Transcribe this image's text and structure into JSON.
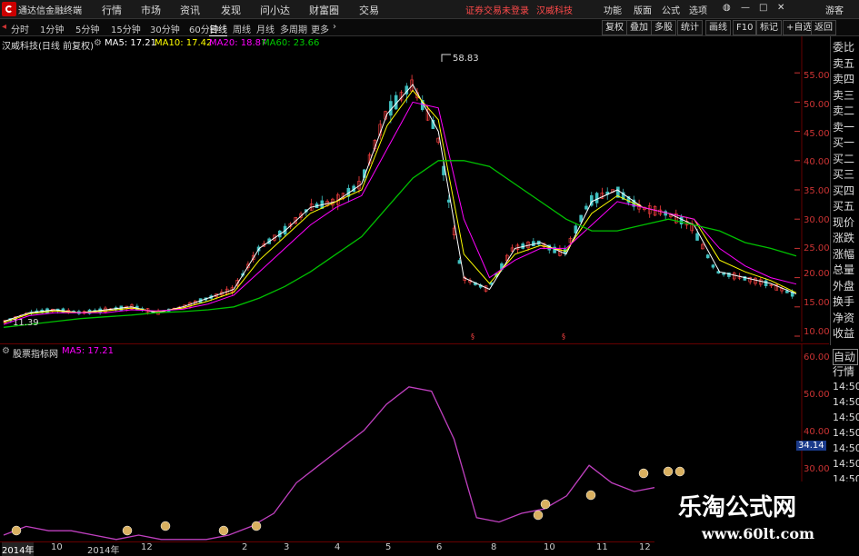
{
  "menubar": {
    "app_title": "通达信金融终端",
    "items": [
      "行情",
      "市场",
      "资讯",
      "发现",
      "问小达",
      "财富圈",
      "交易"
    ],
    "notice": "证券交易未登录",
    "stock_link": "汉威科技",
    "right_items": [
      "功能",
      "版面",
      "公式",
      "选项"
    ],
    "guest": "游客"
  },
  "toolbar": {
    "periods": [
      "分时",
      "1分钟",
      "5分钟",
      "15分钟",
      "30分钟",
      "60分钟",
      "日线",
      "周线",
      "月线",
      "多周期",
      "更多"
    ],
    "active_period": "日线",
    "right_buttons": [
      "复权",
      "叠加",
      "多股",
      "统计",
      "画线",
      "F10",
      "标记",
      "+自选",
      "返回"
    ]
  },
  "main_chart": {
    "title": "汉威科技(日线 前复权)",
    "ma5_label": "MA5: 17.21",
    "ma10_label": "MA10: 17.42",
    "ma20_label": "MA20: 18.87",
    "ma60_label": "MA60: 23.66",
    "high_label": "58.83",
    "low_label": "11.39",
    "y_ticks": [
      "55.00",
      "50.00",
      "45.00",
      "40.00",
      "35.00",
      "30.00",
      "25.00",
      "20.00",
      "15.00",
      "10.00"
    ],
    "colors": {
      "ma5": "#ffffff",
      "ma10": "#ffff00",
      "ma20": "#ff00ff",
      "ma60": "#00c000",
      "up": "#ff4040",
      "down": "#40c0c0"
    }
  },
  "sub_chart": {
    "title": "股票指标网",
    "ma5_label": "MA5: 17.21",
    "y_ticks": [
      "60.00",
      "50.00",
      "40.00",
      "30.00"
    ],
    "current_value": "34.14"
  },
  "right_panel": {
    "items": [
      "委比",
      "卖五",
      "卖四",
      "卖三",
      "卖二",
      "卖一",
      "买一",
      "买二",
      "买三",
      "买四",
      "买五",
      "现价",
      "涨跌",
      "涨幅",
      "总量",
      "外盘",
      "换手",
      "净资",
      "收益"
    ],
    "lower_items": [
      "自动",
      "行情",
      "14:50",
      "14:50",
      "14:50",
      "14:50",
      "14:50",
      "14:50",
      "14:50",
      "14:50"
    ]
  },
  "date_axis": {
    "labels": [
      "2014年",
      "10",
      "2014年",
      "12",
      "2",
      "3",
      "4",
      "5",
      "6",
      "8",
      "10",
      "11",
      "12"
    ]
  },
  "watermark": {
    "title": "乐淘公式网",
    "url": "www.60lt.com"
  },
  "chart_data": {
    "type": "line",
    "title": "汉威科技(日线 前复权)",
    "ylim": [
      10,
      60
    ],
    "series": [
      {
        "name": "MA5",
        "values": [
          12.5,
          14,
          14.5,
          14,
          14.5,
          15,
          14,
          15,
          16.5,
          18,
          25,
          28,
          32,
          33,
          36,
          48,
          53,
          45,
          20,
          18,
          25,
          26,
          24,
          33,
          35,
          32,
          31,
          29,
          21,
          20,
          19,
          17.2
        ]
      },
      {
        "name": "MA10",
        "values": [
          12.3,
          13.8,
          14.3,
          14,
          14.3,
          14.8,
          14.2,
          14.8,
          16,
          17.5,
          23,
          27,
          31,
          33,
          35,
          46,
          52,
          47,
          24,
          19,
          24,
          25.5,
          24.5,
          31,
          34,
          32,
          31,
          30,
          23,
          21,
          19.5,
          17.4
        ]
      },
      {
        "name": "MA20",
        "values": [
          12,
          13.5,
          14,
          14,
          14,
          14.5,
          14.3,
          14.6,
          15.5,
          17,
          21,
          25,
          29,
          32,
          34,
          42,
          50,
          49,
          30,
          20,
          23,
          25,
          25,
          29,
          33,
          32,
          31,
          30,
          25,
          22,
          20,
          18.9
        ]
      },
      {
        "name": "MA60",
        "values": [
          11.5,
          12,
          12.5,
          13,
          13.3,
          13.6,
          14,
          14.2,
          14.5,
          15,
          16.5,
          18.5,
          21,
          24,
          27,
          32,
          37,
          40,
          40,
          39,
          36,
          33,
          30,
          28,
          28,
          29,
          30,
          29,
          28,
          26,
          25,
          23.7
        ]
      }
    ],
    "sub_series": {
      "name": "MA5",
      "values": [
        20,
        22,
        21,
        21,
        20,
        19,
        20,
        19,
        19,
        19,
        20,
        22,
        25,
        32,
        36,
        40,
        44,
        50,
        54,
        53,
        42,
        24,
        23,
        25,
        26,
        29,
        36,
        32,
        30,
        31,
        32,
        28
      ],
      "ylim": [
        20,
        60
      ]
    }
  }
}
